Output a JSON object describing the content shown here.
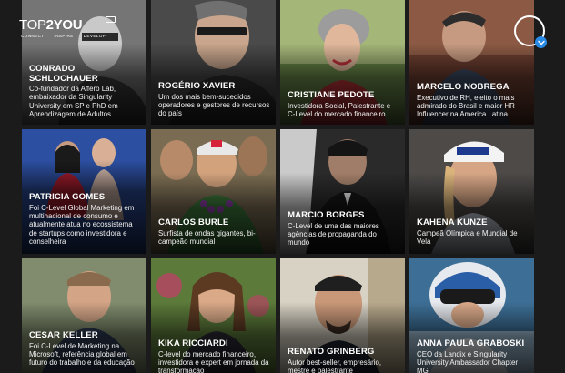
{
  "logo": {
    "word_light": "TOP",
    "word_bold": "2YOU",
    "tags": [
      "CONNECT",
      "INSPIRE",
      "DEVELOP"
    ]
  },
  "scroll_button": {
    "icon": "chevron-down-icon",
    "accent": "#2a8be6"
  },
  "speakers": [
    {
      "name": "CONRADO SCHLOCHAUER",
      "desc": "Co-fundador da Affero Lab, embaixador da Singularity University em SP e PhD em Aprendizagem de Adultos"
    },
    {
      "name": "ROGÉRIO XAVIER",
      "desc": "Um dos mais bem-sucedidos operadores e gestores de recursos do país"
    },
    {
      "name": "CRISTIANE PEDOTE",
      "desc": "Investidora Social, Palestrante e C-Level do mercado financeiro"
    },
    {
      "name": "MARCELO NOBREGA",
      "desc": "Executivo de RH, eleito o mais admirado do Brasil e maior HR Influencer na America Latina"
    },
    {
      "name": "PATRICIA GOMES",
      "desc": "Foi C-Level Global Marketing em multinacional de consumo e atualmente atua no ecossistema de startups como investidora e conselheira"
    },
    {
      "name": "CARLOS BURLE",
      "desc": "Surfista de ondas gigantes, bi-campeão mundial"
    },
    {
      "name": "MARCIO BORGES",
      "desc": "C-Level de uma das maiores agências de propaganda do mundo"
    },
    {
      "name": "KAHENA KUNZE",
      "desc": "Campeã Olímpica e Mundial de Vela"
    },
    {
      "name": "CESAR KELLER",
      "desc": "Foi C-Level de Marketing na Microsoft, referência global em futuro do trabalho e da educação"
    },
    {
      "name": "KIKA RICCIARDI",
      "desc": "C-level do mercado financeiro, investidora e expert em jornada da transformação"
    },
    {
      "name": "RENATO GRINBERG",
      "desc": "Autor best-seller, empresário, mestre e palestrante"
    },
    {
      "name": "ANNA PAULA GRABOSKI",
      "desc": "CEO da Landix e Singularity University Ambassador Chapter MG"
    }
  ]
}
